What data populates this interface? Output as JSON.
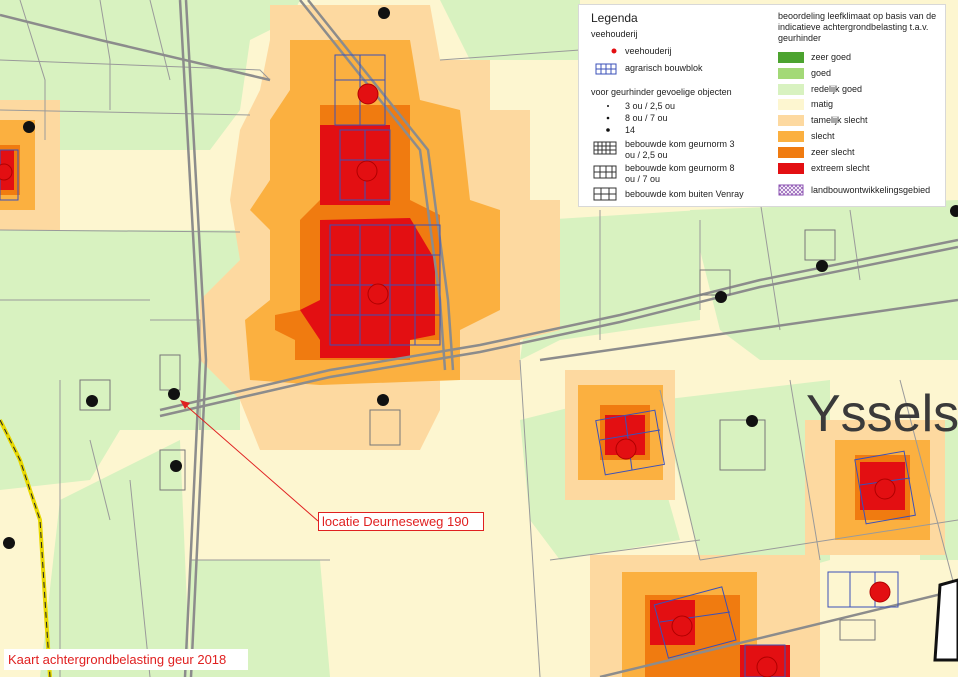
{
  "map": {
    "caption": "Kaart achtergrondbelasting geur 2018",
    "callout": "locatie Deurneseweg 190",
    "place_label": "Yssels"
  },
  "legend": {
    "title": "Legenda",
    "group_veehouderij": "veehouderij",
    "veehouderij": "veehouderij",
    "bouwblok": "agrarisch bouwblok",
    "group_gevoelig": "voor geurhinder gevoelige objecten",
    "obj_1": "3 ou / 2,5 ou",
    "obj_2": "8 ou / 7 ou",
    "obj_3": "14",
    "kom_1": "bebouwde kom geurnorm 3 ou / 2,5 ou",
    "kom_2": "bebouwde kom geurnorm 8 ou / 7 ou",
    "kom_3": "bebouwde kom buiten Venray",
    "group_beoordeling": "beoordeling leefklimaat op basis van de indicatieve achtergrondbelasting t.a.v. geurhinder",
    "classes": [
      {
        "label": "zeer goed",
        "color": "#4ca32f"
      },
      {
        "label": "goed",
        "color": "#a3d977"
      },
      {
        "label": "redelijk goed",
        "color": "#d8f2c0"
      },
      {
        "label": "matig",
        "color": "#fdf6d0"
      },
      {
        "label": "tamelijk slecht",
        "color": "#fdd9a0"
      },
      {
        "label": "slecht",
        "color": "#fbb040"
      },
      {
        "label": "zeer slecht",
        "color": "#f07b10"
      },
      {
        "label": "extreem slecht",
        "color": "#e30f12"
      }
    ],
    "landbouw": "landbouwontwikkelingsgebied"
  }
}
